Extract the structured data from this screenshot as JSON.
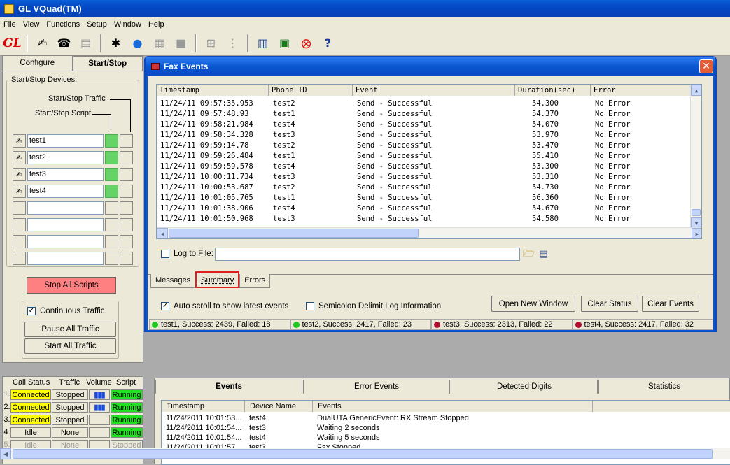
{
  "app": {
    "title": "GL VQuad(TM)"
  },
  "menu": [
    "File",
    "View",
    "Functions",
    "Setup",
    "Window",
    "Help"
  ],
  "left": {
    "tabs": [
      "Configure",
      "Start/Stop"
    ],
    "devices_title": "Start/Stop Devices:",
    "traffic_label": "Start/Stop Traffic",
    "script_label": "Start/Stop Script",
    "devices": [
      "test1",
      "test2",
      "test3",
      "test4",
      "",
      "",
      "",
      ""
    ],
    "stop_all": "Stop All Scripts",
    "continuous": "Continuous Traffic",
    "pause_all": "Pause All Traffic",
    "start_all": "Start All Traffic"
  },
  "callstatus": {
    "headers": [
      "Call Status",
      "Traffic",
      "Volume",
      "Script"
    ],
    "rows": [
      {
        "n": "1.",
        "status": "Connected",
        "traffic": "Stopped",
        "script": "Running"
      },
      {
        "n": "2.",
        "status": "Connected",
        "traffic": "Stopped",
        "script": "Running"
      },
      {
        "n": "3.",
        "status": "Connected",
        "traffic": "Stopped",
        "script": "Running"
      },
      {
        "n": "4.",
        "status": "Idle",
        "traffic": "None",
        "script": "Running"
      },
      {
        "n": "5.",
        "status": "Idle",
        "traffic": "None",
        "script": "Stopped"
      }
    ]
  },
  "fax": {
    "title": "Fax Events",
    "columns": [
      "Timestamp",
      "Phone ID",
      "Event",
      "Duration(sec)",
      "Error"
    ],
    "rows": [
      [
        "11/24/11 09:57:35.953",
        "test2",
        "Send - Successful",
        "54.300",
        "No Error"
      ],
      [
        "11/24/11 09:57:48.93",
        "test1",
        "Send - Successful",
        "54.370",
        "No Error"
      ],
      [
        "11/24/11 09:58:21.984",
        "test4",
        "Send - Successful",
        "54.070",
        "No Error"
      ],
      [
        "11/24/11 09:58:34.328",
        "test3",
        "Send - Successful",
        "53.970",
        "No Error"
      ],
      [
        "11/24/11 09:59:14.78",
        "test2",
        "Send - Successful",
        "53.470",
        "No Error"
      ],
      [
        "11/24/11 09:59:26.484",
        "test1",
        "Send - Successful",
        "55.410",
        "No Error"
      ],
      [
        "11/24/11 09:59:59.578",
        "test4",
        "Send - Successful",
        "53.300",
        "No Error"
      ],
      [
        "11/24/11 10:00:11.734",
        "test3",
        "Send - Successful",
        "53.310",
        "No Error"
      ],
      [
        "11/24/11 10:00:53.687",
        "test2",
        "Send - Successful",
        "54.730",
        "No Error"
      ],
      [
        "11/24/11 10:01:05.765",
        "test1",
        "Send - Successful",
        "56.360",
        "No Error"
      ],
      [
        "11/24/11 10:01:38.906",
        "test4",
        "Send - Successful",
        "54.670",
        "No Error"
      ],
      [
        "11/24/11 10:01:50.968",
        "test3",
        "Send - Successful",
        "54.580",
        "No Error"
      ]
    ],
    "log_to_file": "Log to File:",
    "log_path": "",
    "tabs": [
      "Messages",
      "Summary",
      "Errors"
    ],
    "autoscroll": "Auto scroll to show latest events",
    "semicolon": "Semicolon Delimit Log Information",
    "btn_open": "Open New Window",
    "btn_clear_status": "Clear Status",
    "btn_clear_events": "Clear Events",
    "status": [
      {
        "text": "test1, Success: 2439, Failed: 18",
        "color": "#1ec81e"
      },
      {
        "text": "test2, Success: 2417, Failed: 23",
        "color": "#1ec81e"
      },
      {
        "text": "test3, Success: 2313, Failed: 22",
        "color": "#b01030"
      },
      {
        "text": "test4, Success: 2417, Failed: 32",
        "color": "#b01030"
      }
    ]
  },
  "events": {
    "tabs": [
      "Events",
      "Error Events",
      "Detected Digits",
      "Statistics"
    ],
    "columns": [
      "Timestamp",
      "Device Name",
      "Events"
    ],
    "rows": [
      [
        "11/24/2011 10:01:53...",
        "test4",
        "DualUTA GenericEvent: RX Stream Stopped"
      ],
      [
        "11/24/2011 10:01:54...",
        "test3",
        "Waiting 2 seconds"
      ],
      [
        "11/24/2011 10:01:54...",
        "test4",
        "Waiting 5 seconds"
      ],
      [
        "11/24/2011 10:01:57...",
        "test3",
        "Fax Stopped"
      ]
    ]
  }
}
